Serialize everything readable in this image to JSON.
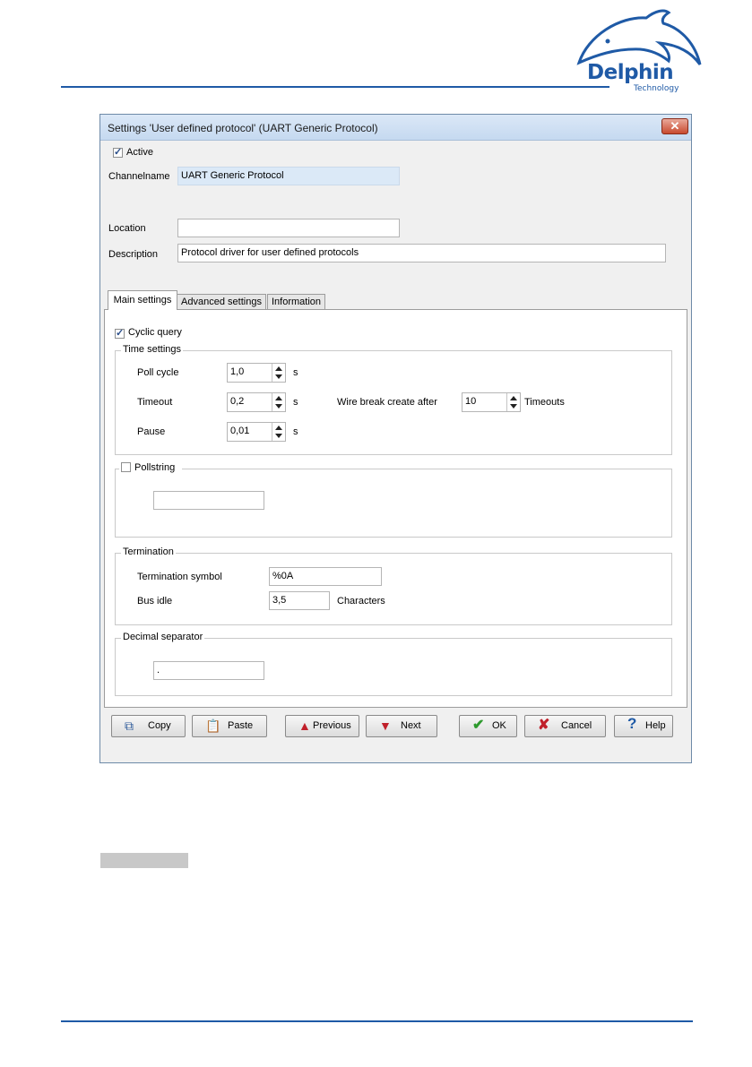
{
  "page": {
    "logo_text": "Delphin",
    "logo_subtext": "Technology"
  },
  "colors": {
    "accent": "#1f5aa6",
    "dialog_bg": "#f0f0f0",
    "channelname_bg": "#dbe9f7"
  },
  "dialog": {
    "title": "Settings 'User defined protocol' (UART Generic Protocol)",
    "close_label": "✕",
    "active_label": "Active",
    "active_checked": true,
    "channelname_label": "Channelname",
    "channelname_value": "UART Generic Protocol",
    "location_label": "Location",
    "location_value": "",
    "description_label": "Description",
    "description_value": "Protocol driver for user defined protocols"
  },
  "tabs": [
    {
      "label": "Main settings",
      "active": true
    },
    {
      "label": "Advanced settings",
      "active": false
    },
    {
      "label": "Information",
      "active": false
    }
  ],
  "main": {
    "cyclic_query_label": "Cyclic query",
    "cyclic_query_checked": true,
    "time_settings": {
      "title": "Time settings",
      "poll_cycle_label": "Poll cycle",
      "poll_cycle_value": "1,0",
      "poll_cycle_unit": "s",
      "timeout_label": "Timeout",
      "timeout_value": "0,2",
      "timeout_unit": "s",
      "pause_label": "Pause",
      "pause_value": "0,01",
      "pause_unit": "s",
      "wire_break_label": "Wire break create after",
      "wire_break_value": "10",
      "wire_break_unit": "Timeouts"
    },
    "pollstring": {
      "label": "Pollstring",
      "checked": false,
      "value": ""
    },
    "termination": {
      "title": "Termination",
      "symbol_label": "Termination symbol",
      "symbol_value": "%0A",
      "bus_idle_label": "Bus idle",
      "bus_idle_value": "3,5",
      "bus_idle_unit": "Characters"
    },
    "decimal_separator": {
      "title": "Decimal separator",
      "value": "."
    }
  },
  "buttons": {
    "copy": "Copy",
    "paste": "Paste",
    "previous": "Previous",
    "next": "Next",
    "ok": "OK",
    "cancel": "Cancel",
    "help": "Help"
  }
}
